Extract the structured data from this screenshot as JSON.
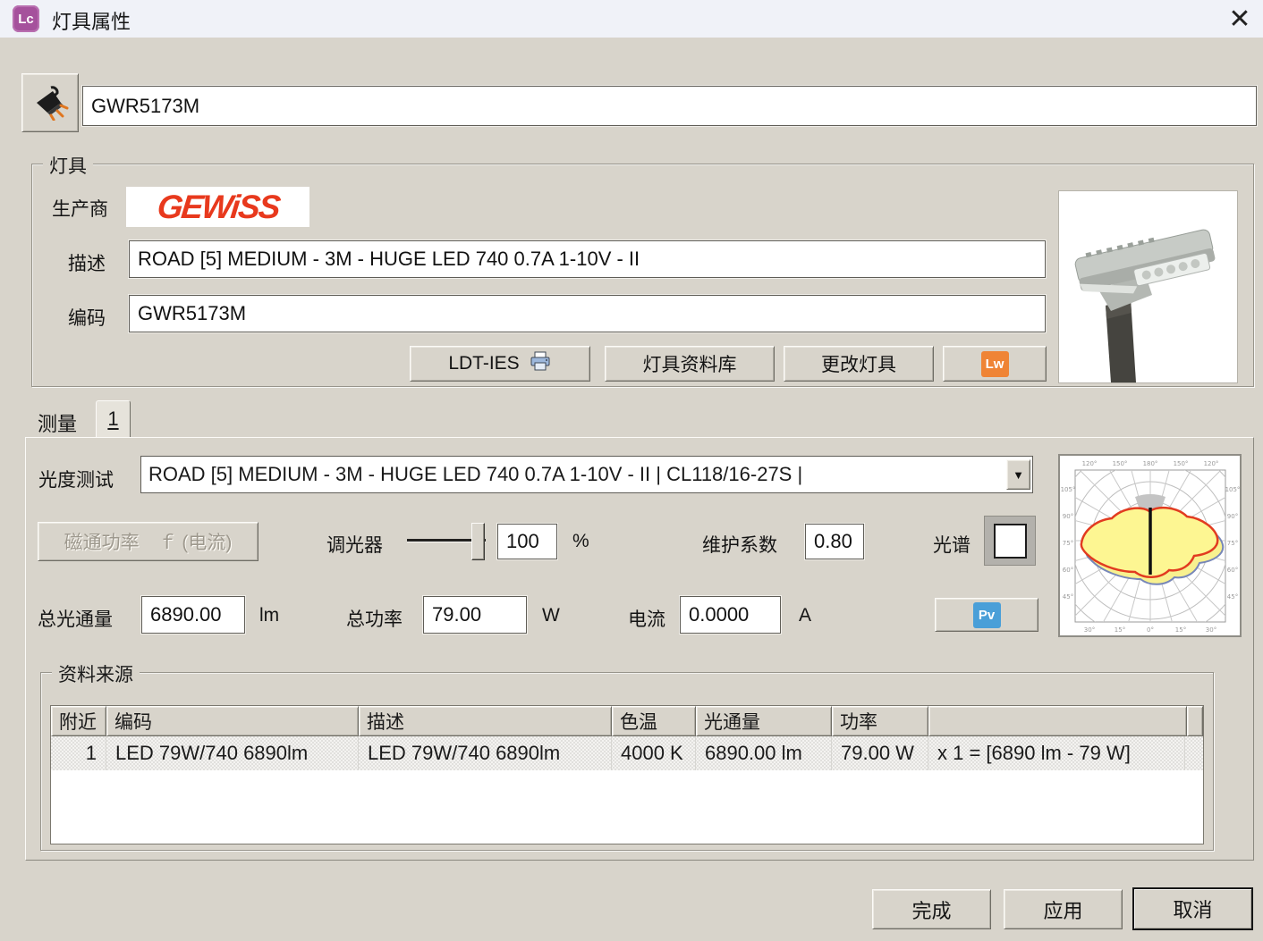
{
  "window": {
    "title": "灯具属性"
  },
  "icons": {
    "app_badge": "Lc",
    "close_glyph": "✕",
    "dropdown_glyph": "▼"
  },
  "header": {
    "name_value": "GWR5173M"
  },
  "luminaire_group": {
    "title": "灯具",
    "manufacturer_label": "生产商",
    "manufacturer_logo": "GEWiSS",
    "description_label": "描述",
    "description_value": "ROAD [5] MEDIUM - 3M - HUGE LED 740 0.7A 1-10V - II",
    "code_label": "编码",
    "code_value": "GWR5173M",
    "buttons": {
      "ldt_ies": "LDT-IES",
      "library": "灯具资料库",
      "change": "更改灯具",
      "lw_badge": "Lw"
    }
  },
  "measurement": {
    "tab_label": "测量",
    "tab_number": "1",
    "photometry_label": "光度测试",
    "photometry_value": "ROAD [5] MEDIUM - 3M - HUGE LED 740 0.7A 1-10V - II | CL118/16-27S |",
    "flux_power_button": "磁通功率　ｆ (电流)",
    "dimmer_label": "调光器",
    "dimmer_value": "100",
    "dimmer_unit": "%",
    "maintenance_label": "维护系数",
    "maintenance_value": "0.80",
    "spectrum_label": "光谱",
    "total_flux_label": "总光通量",
    "total_flux_value": "6890.00",
    "total_flux_unit": "lm",
    "total_power_label": "总功率",
    "total_power_value": "79.00",
    "total_power_unit": "W",
    "current_label": "电流",
    "current_value": "0.0000",
    "current_unit": "A",
    "pv_badge": "Pv"
  },
  "polar_labels": {
    "top": [
      "120°",
      "150°",
      "180°",
      "150°",
      "120°"
    ],
    "bottom": [
      "30°",
      "15°",
      "0°",
      "15°",
      "30°"
    ],
    "left": [
      "105°",
      "90°",
      "75°",
      "60°",
      "45°"
    ],
    "right": [
      "105°",
      "90°",
      "75°",
      "60°",
      "45°"
    ]
  },
  "source_group": {
    "title": "资料来源",
    "columns": [
      "附近",
      "编码",
      "描述",
      "色温",
      "光通量",
      "功率",
      ""
    ],
    "rows": [
      [
        "1",
        "LED 79W/740 6890lm",
        "LED 79W/740 6890lm",
        "4000 K",
        "6890.00 lm",
        "79.00 W",
        "x 1 = [6890 lm - 79 W]"
      ]
    ]
  },
  "footer": {
    "finish": "完成",
    "apply": "应用",
    "cancel": "取消"
  },
  "colors": {
    "accent_magenta": "#a5519c",
    "logo_red": "#e8391d",
    "lw_orange": "#ef8435",
    "pv_blue": "#4a9fd8"
  }
}
